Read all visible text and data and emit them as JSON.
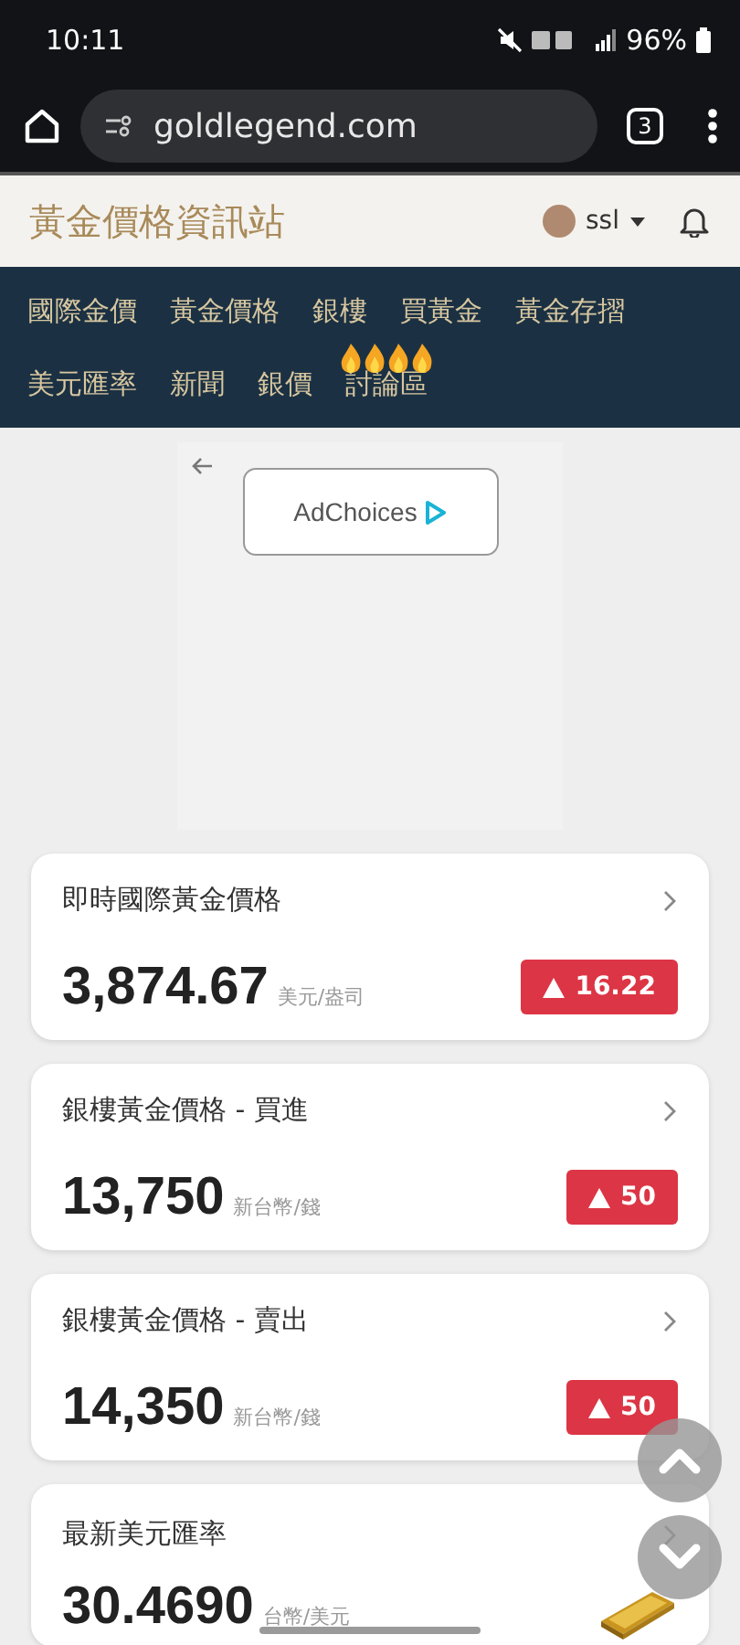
{
  "status_bar": {
    "time": "10:11",
    "battery": "96%"
  },
  "browser": {
    "url": "goldlegend.com",
    "tab_count": "3"
  },
  "header": {
    "title": "黃金價格資訊站",
    "user": "ssl"
  },
  "nav": [
    {
      "label": "國際金價",
      "hot": false
    },
    {
      "label": "黃金價格",
      "hot": false
    },
    {
      "label": "銀樓",
      "hot": false
    },
    {
      "label": "買黃金",
      "hot": false
    },
    {
      "label": "黃金存摺",
      "hot": false
    },
    {
      "label": "美元匯率",
      "hot": false
    },
    {
      "label": "新聞",
      "hot": false
    },
    {
      "label": "銀價",
      "hot": false
    },
    {
      "label": "討論區",
      "hot": true
    }
  ],
  "ad": {
    "label": "AdChoices"
  },
  "cards": [
    {
      "kind": "price",
      "title": "即時國際黃金價格",
      "value": "3,874.67",
      "unit": "美元/盎司",
      "change": "16.22"
    },
    {
      "kind": "price",
      "title": "銀樓黃金價格 - 買進",
      "value": "13,750",
      "unit": "新台幣/錢",
      "change": "50"
    },
    {
      "kind": "price",
      "title": "銀樓黃金價格 - 賣出",
      "value": "14,350",
      "unit": "新台幣/錢",
      "change": "50"
    },
    {
      "kind": "rate",
      "title": "最新美元匯率",
      "value": "30.4690",
      "unit": "台幣/美元"
    }
  ]
}
